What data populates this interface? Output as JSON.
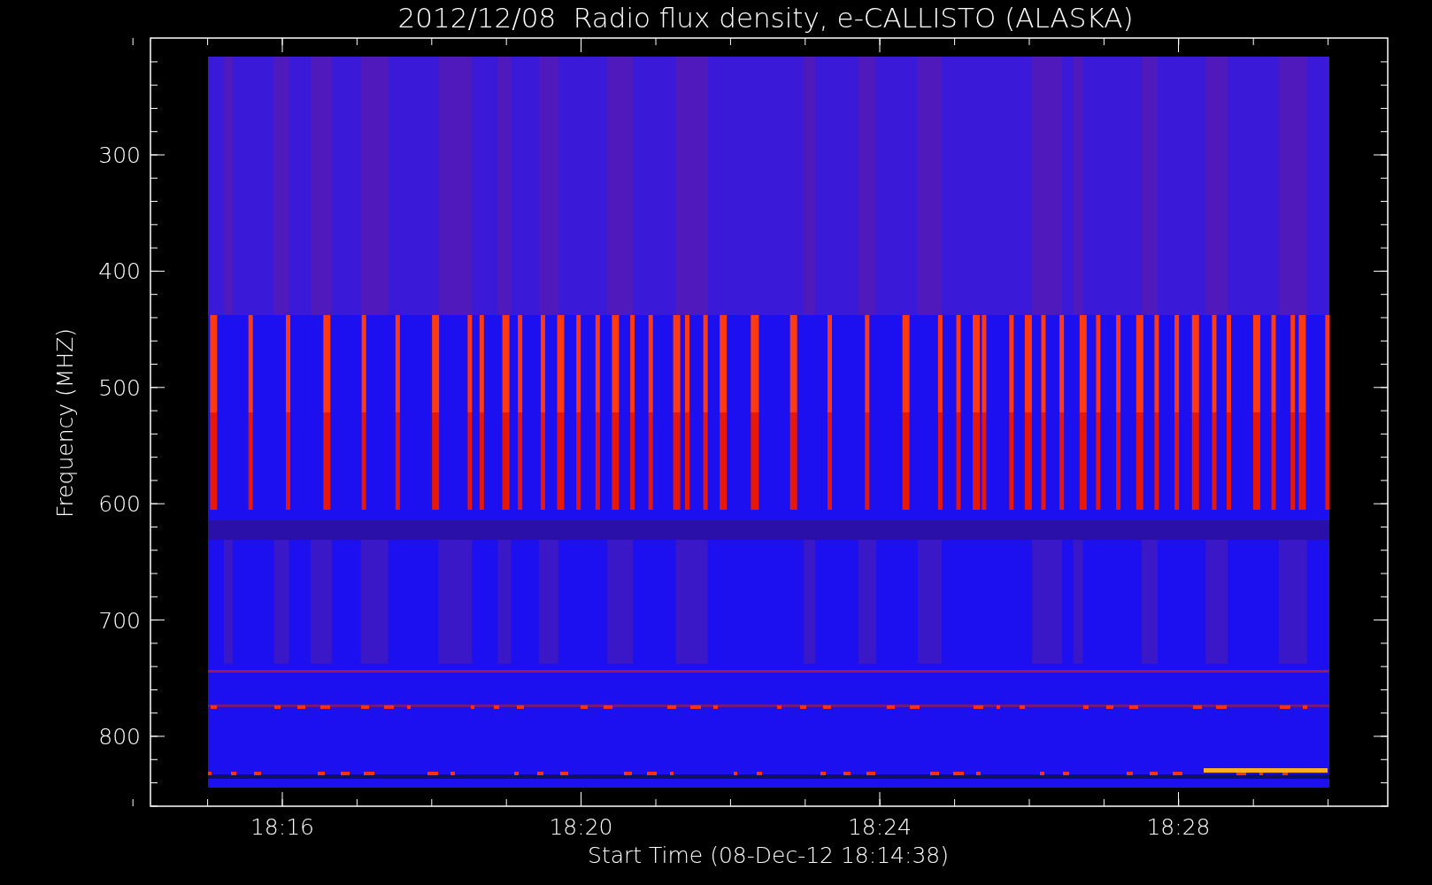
{
  "title": "2012/12/08  Radio flux density, e-CALLISTO (ALASKA)",
  "y_axis": {
    "label": "Frequency (MHZ)",
    "ticks": [
      "300",
      "400",
      "500",
      "600",
      "700",
      "800"
    ]
  },
  "x_axis": {
    "label": "Start Time (08-Dec-12 18:14:38)",
    "ticks": [
      "18:16",
      "18:20",
      "18:24",
      "18:28"
    ]
  }
}
